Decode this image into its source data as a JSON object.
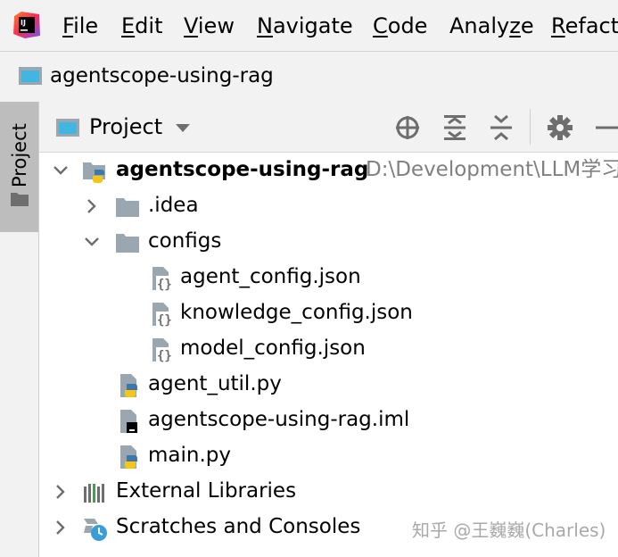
{
  "menu": {
    "items": [
      {
        "mnemonic": "F",
        "rest": "ile"
      },
      {
        "mnemonic": "E",
        "rest": "dit"
      },
      {
        "mnemonic": "V",
        "rest": "iew"
      },
      {
        "mnemonic": "N",
        "rest": "avigate"
      },
      {
        "mnemonic": "C",
        "rest": "ode"
      },
      {
        "prefix": "Analy",
        "mnemonic": "z",
        "rest": "e"
      },
      {
        "mnemonic": "R",
        "rest": "efactor"
      }
    ]
  },
  "navbar": {
    "project_name": "agentscope-using-rag"
  },
  "stripe": {
    "tab_label": "Project"
  },
  "tool_window": {
    "title": "Project",
    "icons": [
      "locate-icon",
      "expand-all-icon",
      "collapse-all-icon",
      "gear-icon",
      "hide-icon"
    ]
  },
  "tree": {
    "root": {
      "name": "agentscope-using-rag",
      "path": "D:\\Development\\LLM学习"
    },
    "idea": "idea_label",
    "items": {
      "idea": ".idea",
      "configs": "configs",
      "agent_config": "agent_config.json",
      "knowledge_config": "knowledge_config.json",
      "model_config": "model_config.json",
      "agent_util": "agent_util.py",
      "iml": "agentscope-using-rag.iml",
      "main": "main.py",
      "external": "External Libraries",
      "scratches": "Scratches and Consoles"
    }
  },
  "watermark": "知乎 @王巍巍(Charles)",
  "colors": {
    "menu_bg": "#f2f2f2",
    "tree_bg": "#ffffff",
    "stripe_selected": "#bdbdbd",
    "path_text": "#808080",
    "folder": "#9aa7b0",
    "python_blue": "#3c78aa",
    "python_yellow": "#f5c518"
  }
}
